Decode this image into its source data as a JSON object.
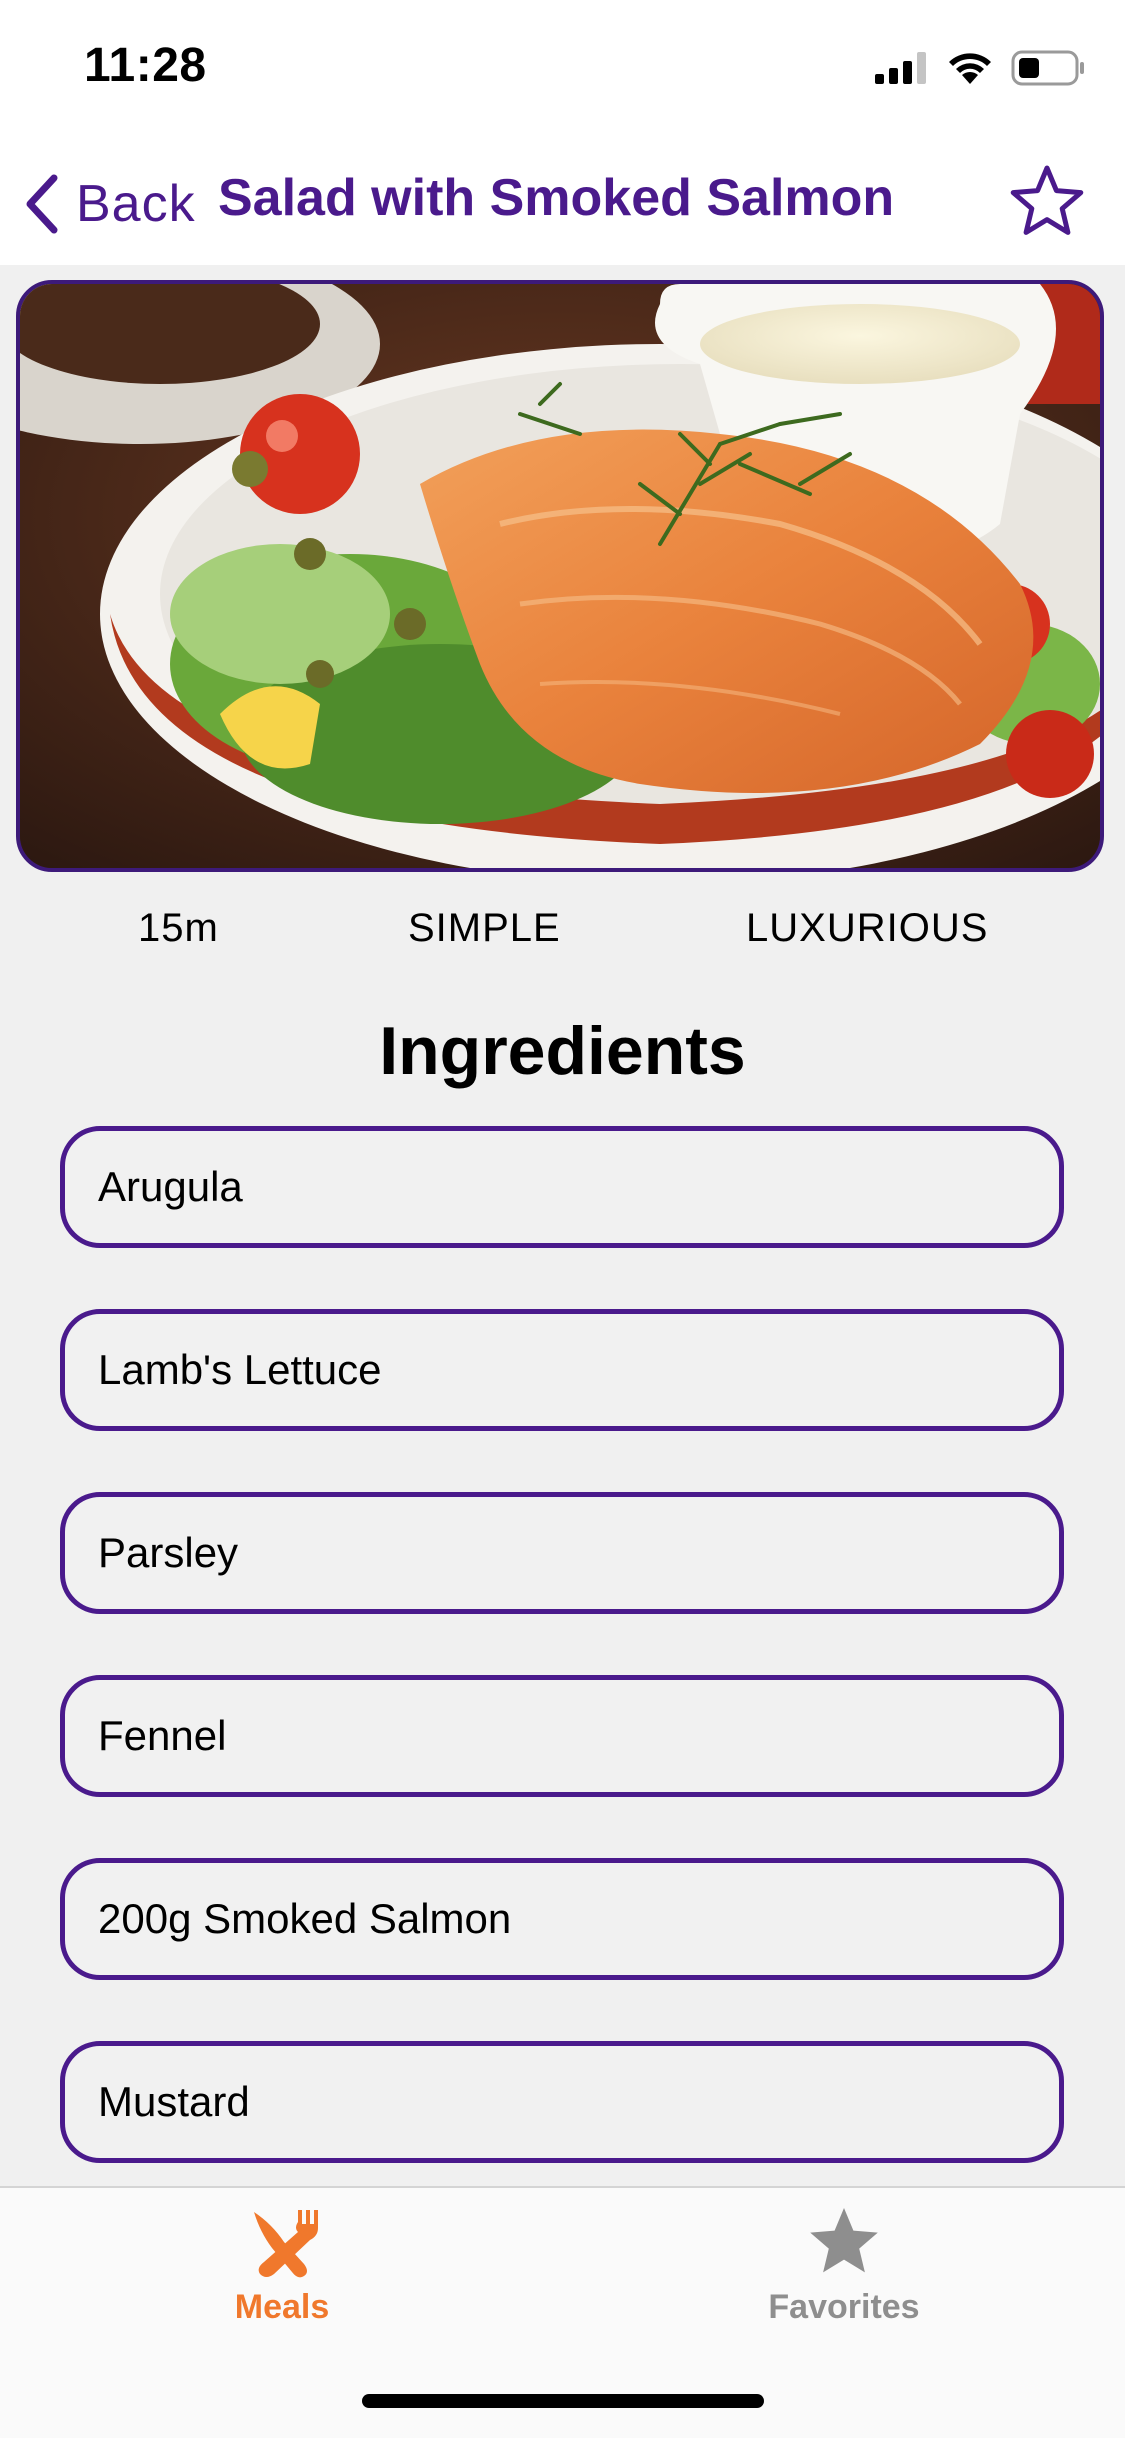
{
  "status_bar": {
    "time": "11:28"
  },
  "nav": {
    "back_label": "Back",
    "title": "Salad with Smoked Salmon"
  },
  "hero": {
    "alt": "Salad with Smoked Salmon photo"
  },
  "meta": {
    "duration": "15m",
    "complexity": "SIMPLE",
    "affordability": "LUXURIOUS"
  },
  "ingredients": {
    "heading": "Ingredients",
    "items": [
      "Arugula",
      "Lamb's Lettuce",
      "Parsley",
      "Fennel",
      "200g Smoked Salmon",
      "Mustard"
    ]
  },
  "tabs": {
    "meals": {
      "label": "Meals",
      "icon": "fork-knife-icon",
      "active": true
    },
    "favorites": {
      "label": "Favorites",
      "icon": "star-icon",
      "active": false
    }
  },
  "colors": {
    "accent": "#4a1a8c",
    "active_tab": "#f0782c",
    "inactive_tab": "#8e8e8e",
    "background": "#f0f0f0"
  }
}
